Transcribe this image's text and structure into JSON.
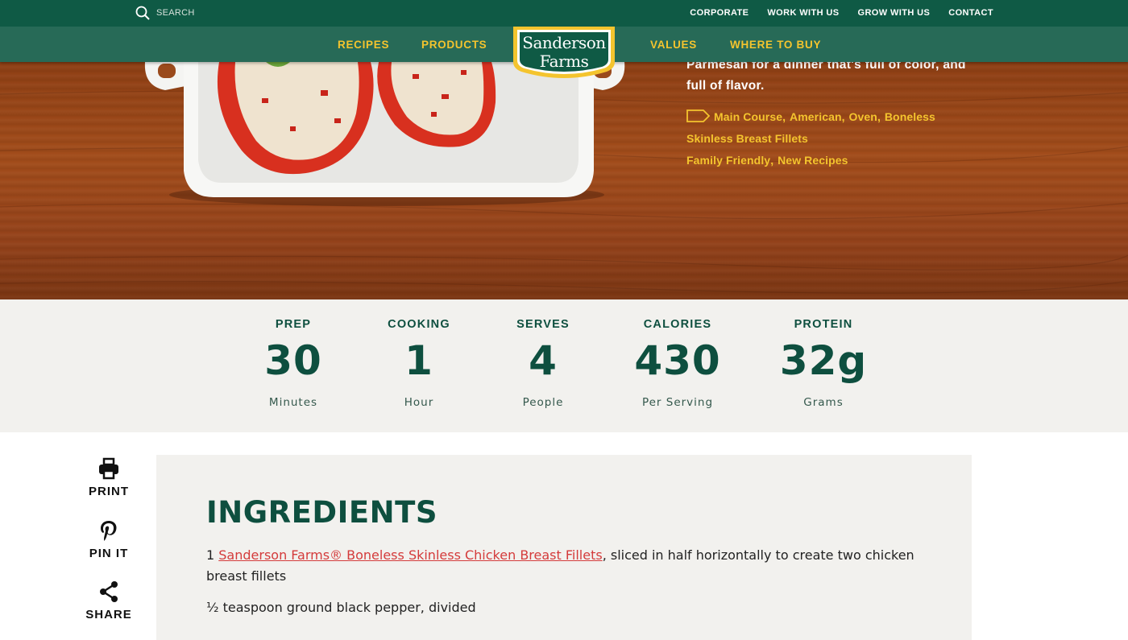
{
  "utility_nav": {
    "search_label": "SEARCH",
    "links": [
      "CORPORATE",
      "WORK WITH US",
      "GROW WITH US",
      "CONTACT"
    ]
  },
  "main_nav": {
    "left": [
      "RECIPES",
      "PRODUCTS"
    ],
    "right": [
      "VALUES",
      "WHERE TO BUY"
    ],
    "logo": {
      "line1": "Sanderson",
      "line2": "Farms"
    }
  },
  "hero": {
    "description_visible": "Parmesan for a dinner that's full of color, and full of flavor.",
    "tags": [
      "Main Course",
      "American",
      "Oven",
      "Boneless Skinless Breast Fillets",
      "Family Friendly",
      "New Recipes"
    ]
  },
  "stats": [
    {
      "label": "PREP",
      "value": "30",
      "unit": "Minutes"
    },
    {
      "label": "COOKING",
      "value": "1",
      "unit": "Hour"
    },
    {
      "label": "SERVES",
      "value": "4",
      "unit": "People"
    },
    {
      "label": "CALORIES",
      "value": "430",
      "unit": "Per Serving"
    },
    {
      "label": "PROTEIN",
      "value": "32g",
      "unit": "Grams"
    }
  ],
  "social": {
    "print": "PRINT",
    "pin": "PIN IT",
    "share": "SHARE"
  },
  "ingredients": {
    "title": "INGREDIENTS",
    "item1": {
      "qty": "1 ",
      "link": "Sanderson Farms® Boneless Skinless Chicken Breast Fillets",
      "rest": ", sliced in half horizontally to create two chicken breast fillets"
    },
    "item2": "¹⁄₂ teaspoon ground black pepper, divided"
  },
  "colors": {
    "top_bar": "#0f5a45",
    "main_nav": "#276a57",
    "accent_yellow": "#f4c42e",
    "heading_green": "#0e4f3f",
    "link_red": "#d43b3b",
    "panel_bg": "#f2f1ee"
  },
  "icons": [
    "search-icon",
    "tag-icon",
    "print-icon",
    "pinterest-icon",
    "share-icon"
  ]
}
